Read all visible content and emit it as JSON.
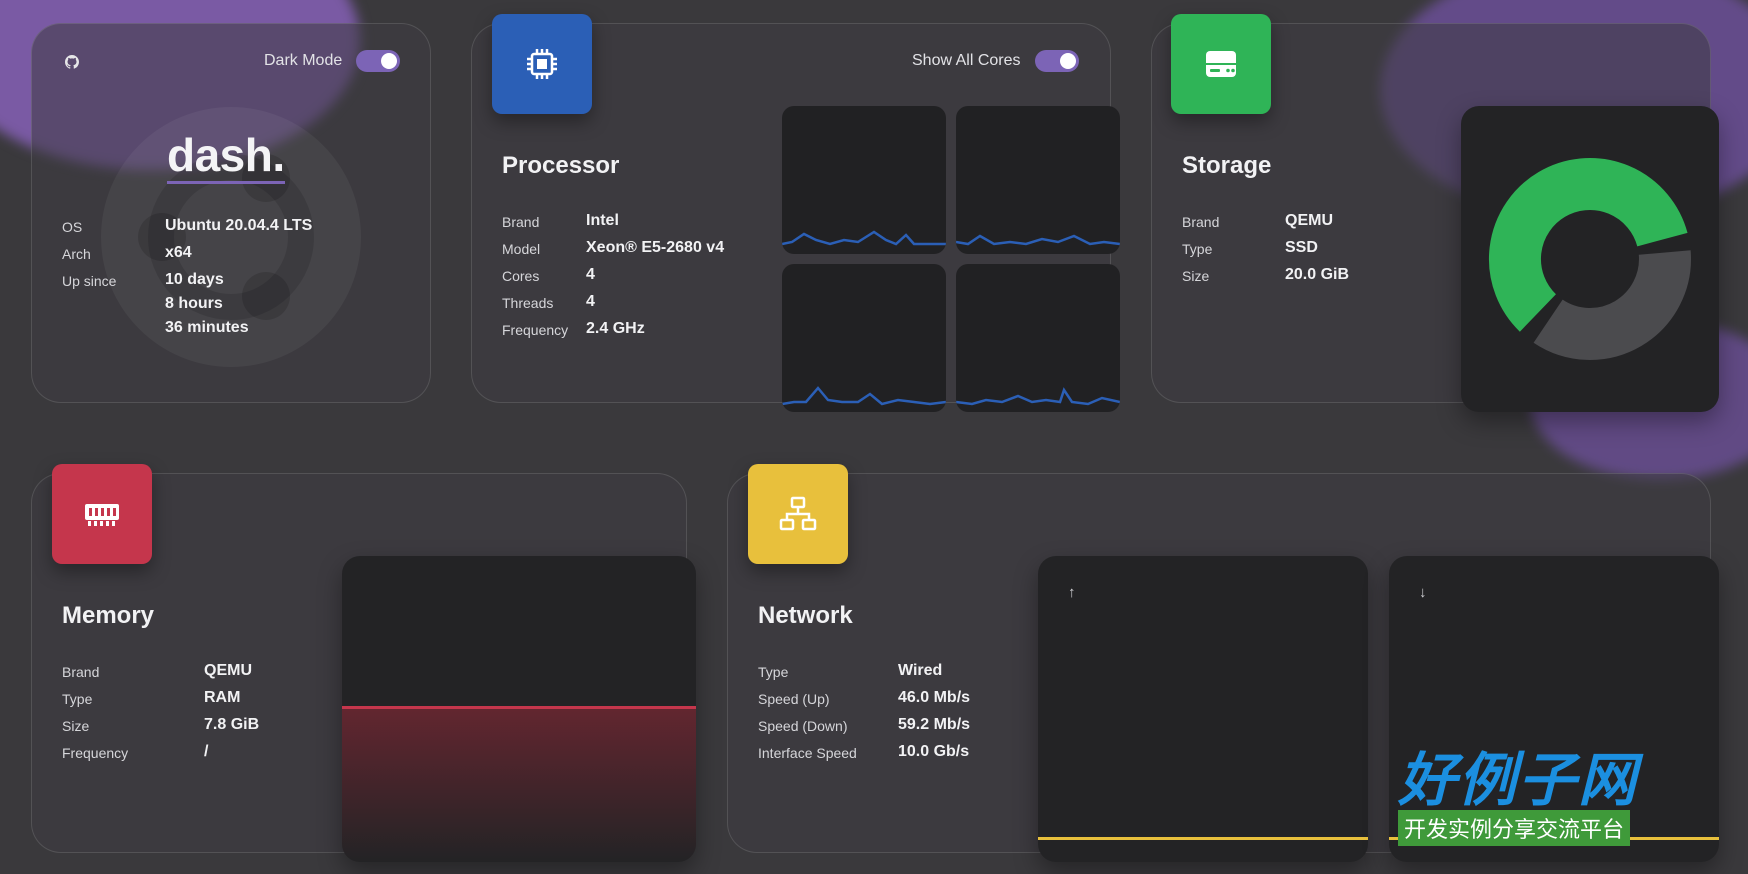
{
  "theme": {
    "accent_purple": "#7c64b6",
    "processor_color": "#2b5fb6",
    "storage_color": "#2fb457",
    "memory_color": "#c5364c",
    "network_color": "#e8c03c"
  },
  "overview": {
    "github_icon": "github-icon",
    "dark_mode_label": "Dark Mode",
    "logo_text": "dash.",
    "rows": [
      {
        "key": "OS",
        "value": "Ubuntu 20.04.4 LTS"
      },
      {
        "key": "Arch",
        "value": "x64"
      },
      {
        "key": "Up since",
        "value": "10 days"
      }
    ],
    "uptime_extra": [
      "8 hours",
      "36 minutes"
    ]
  },
  "processor": {
    "icon": "cpu-icon",
    "title": "Processor",
    "show_all_cores_label": "Show All Cores",
    "rows": [
      {
        "key": "Brand",
        "value": "Intel"
      },
      {
        "key": "Model",
        "value": "Xeon® E5-2680 v4"
      },
      {
        "key": "Cores",
        "value": "4"
      },
      {
        "key": "Threads",
        "value": "4"
      },
      {
        "key": "Frequency",
        "value": "2.4 GHz"
      }
    ]
  },
  "storage": {
    "icon": "hard-drive-icon",
    "title": "Storage",
    "rows": [
      {
        "key": "Brand",
        "value": "QEMU"
      },
      {
        "key": "Type",
        "value": "SSD"
      },
      {
        "key": "Size",
        "value": "20.0 GiB"
      }
    ],
    "used_fraction": 0.6
  },
  "memory": {
    "icon": "ram-icon",
    "title": "Memory",
    "rows": [
      {
        "key": "Brand",
        "value": "QEMU"
      },
      {
        "key": "Type",
        "value": "RAM"
      },
      {
        "key": "Size",
        "value": "7.8 GiB"
      },
      {
        "key": "Frequency",
        "value": "/"
      }
    ],
    "usage_fraction": 0.5
  },
  "network": {
    "icon": "network-icon",
    "title": "Network",
    "rows": [
      {
        "key": "Type",
        "value": "Wired"
      },
      {
        "key": "Speed (Up)",
        "value": "46.0 Mb/s"
      },
      {
        "key": "Speed (Down)",
        "value": "59.2 Mb/s"
      },
      {
        "key": "Interface Speed",
        "value": "10.0 Gb/s"
      }
    ],
    "up_arrow": "↑",
    "down_arrow": "↓"
  },
  "watermark": {
    "brand_text": "好例子网",
    "brand_subtext": "开发实例分享交流平台"
  }
}
